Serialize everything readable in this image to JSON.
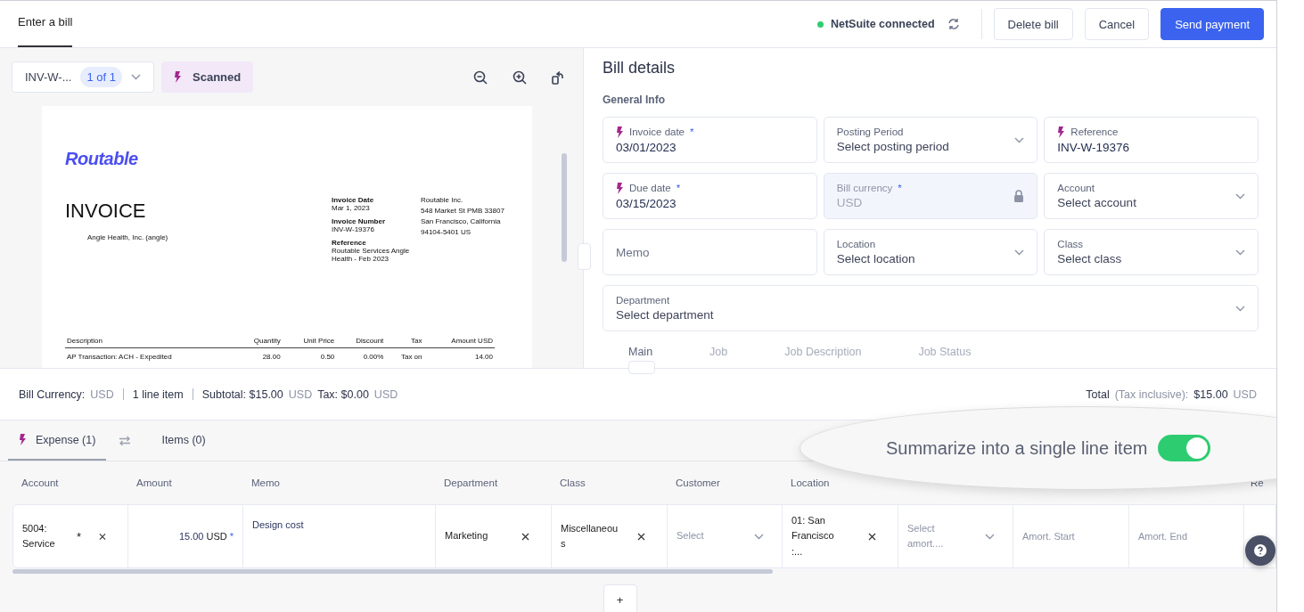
{
  "header": {
    "tab": "Enter a bill",
    "status": {
      "label": "NetSuite connected",
      "color": "#2ecc71"
    },
    "buttons": [
      {
        "label": "Delete bill",
        "kind": "secondary"
      },
      {
        "label": "Cancel",
        "kind": "secondary"
      },
      {
        "label": "Send payment",
        "kind": "primary"
      }
    ]
  },
  "viewer": {
    "document_select": {
      "value": "INV-W-...",
      "badge": "1 of 1"
    },
    "scanned_badge": "Scanned",
    "document": {
      "logo": "Routable",
      "title": "INVOICE",
      "customer": "Angle Health, Inc. (angle)",
      "meta": [
        {
          "label": "Invoice Date",
          "value": "Mar 1, 2023"
        },
        {
          "label": "Invoice Number",
          "value": "INV-W-19376"
        },
        {
          "label": "Reference",
          "value": "Routable Services Angle Health - Feb 2023"
        }
      ],
      "address": [
        "Routable Inc.",
        "548 Market St PMB 33807",
        "San Francisco, California",
        "94104-5401 US"
      ],
      "columns": [
        "Description",
        "Quantity",
        "Unit Price",
        "Discount",
        "Tax",
        "Amount USD"
      ],
      "rows": [
        [
          "AP Transaction: ACH - Expedited",
          "28.00",
          "0.50",
          "0.00%",
          "Tax on",
          "14.00"
        ]
      ]
    }
  },
  "bill_details": {
    "title": "Bill details",
    "section": "General Info",
    "rows": [
      [
        {
          "kind": "text",
          "label": "Invoice date",
          "required_mark": "*",
          "value": "03/01/2023",
          "scanned": true
        },
        {
          "kind": "select",
          "label": "Posting Period",
          "placeholder": "Select posting period",
          "scanned": false
        },
        {
          "kind": "text",
          "label": "Reference",
          "value": "INV-W-19376",
          "scanned": true
        }
      ],
      [
        {
          "kind": "text",
          "label": "Due date",
          "required_mark": "*",
          "value": "03/15/2023",
          "scanned": true
        },
        {
          "kind": "locked",
          "label": "Bill currency",
          "required_mark": "*",
          "value": "USD",
          "scanned": false
        },
        {
          "kind": "select",
          "label": "Account",
          "placeholder": "Select account",
          "scanned": false
        }
      ],
      [
        {
          "kind": "text",
          "placeholder": "Memo",
          "scanned": false
        },
        {
          "kind": "select",
          "label": "Location",
          "placeholder": "Select location",
          "scanned": false
        },
        {
          "kind": "select",
          "label": "Class",
          "placeholder": "Select class",
          "scanned": false
        }
      ],
      [
        {
          "kind": "select",
          "label": "Department",
          "placeholder": "Select department",
          "scanned": false
        }
      ]
    ],
    "subtabs": [
      {
        "label": "Main",
        "selected": true
      },
      {
        "label": "Job",
        "selected": false
      },
      {
        "label": "Job Description",
        "selected": false
      },
      {
        "label": "Job Status",
        "selected": false
      }
    ]
  },
  "summary": {
    "left": [
      [
        {
          "text": "Bill Currency:",
          "muted": false
        },
        {
          "text": "USD",
          "muted": true
        }
      ],
      [
        {
          "text": "1 line item",
          "muted": false
        }
      ],
      [
        {
          "text": "Subtotal: $15.00",
          "muted": false
        },
        {
          "text": "USD",
          "muted": true
        },
        {
          "text": "Tax: $0.00",
          "muted": false
        },
        {
          "text": "USD",
          "muted": true
        }
      ]
    ],
    "right": [
      {
        "text": "Total",
        "muted": false
      },
      {
        "text": "(Tax inclusive):",
        "muted": true
      },
      {
        "text": "$15.00",
        "muted": false
      },
      {
        "text": "USD",
        "muted": true
      }
    ]
  },
  "line_tabs": [
    {
      "label": "Expense (1)",
      "selected": true,
      "scanned": true
    },
    {
      "label": "Items (0)",
      "selected": false,
      "scanned": false
    }
  ],
  "summarize": {
    "label": "Summarize into a single line item",
    "on": true
  },
  "table": {
    "columns": [
      "Account",
      "Amount",
      "Memo",
      "Department",
      "Class",
      "Customer",
      "Location",
      "Re"
    ],
    "rows": [
      [
        {
          "kind": "choice",
          "value": "5004: Service",
          "required_mark": "*"
        },
        {
          "kind": "amount",
          "value": "15.00",
          "unit": "USD",
          "required_mark": "*"
        },
        {
          "kind": "text",
          "value": "Design cost"
        },
        {
          "kind": "choice",
          "value": "Marketing"
        },
        {
          "kind": "choice",
          "value": "Miscellaneous"
        },
        {
          "kind": "select",
          "placeholder": "Select"
        },
        {
          "kind": "choice",
          "value": "01: San Francisco :..."
        },
        {
          "kind": "select",
          "placeholder": "Select amort...."
        },
        {
          "kind": "input",
          "placeholder": "Amort. Start"
        },
        {
          "kind": "input",
          "placeholder": "Amort. End"
        }
      ]
    ],
    "add_label": "+"
  }
}
